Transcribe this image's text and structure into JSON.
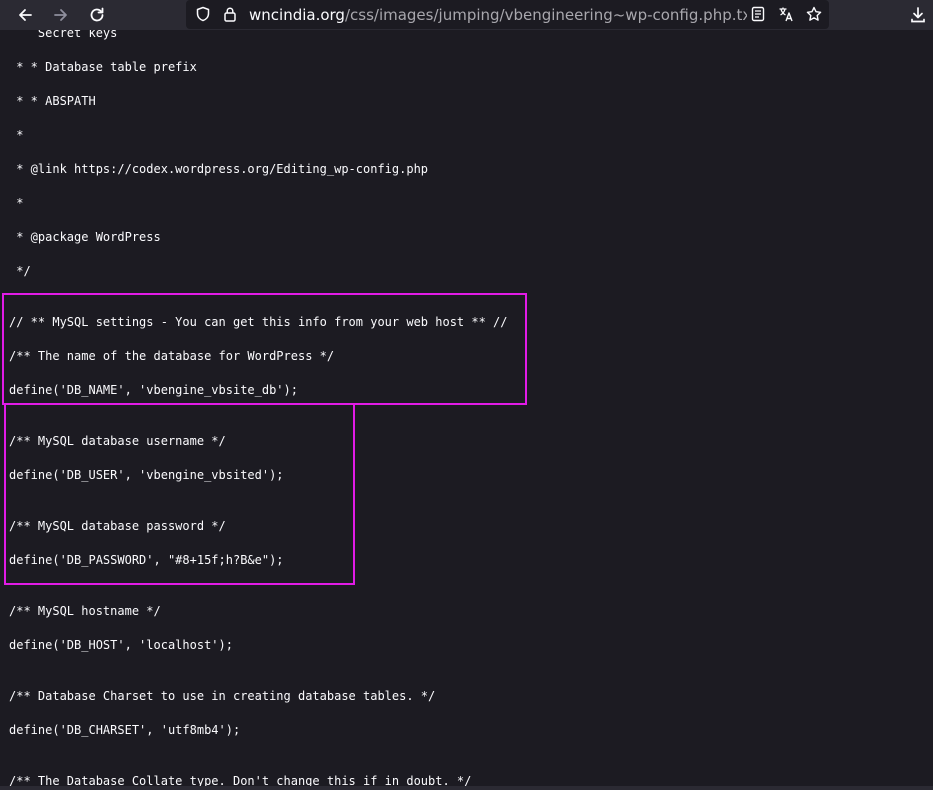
{
  "browser": {
    "url_host": "wncindia.org",
    "url_path": "/css/images/jumping/vbengineering~wp-config.php.txt",
    "icons": [
      "back-icon",
      "forward-icon",
      "reload-icon",
      "shield-icon",
      "lock-icon",
      "reader-view-icon",
      "translate-icon",
      "bookmark-star-icon",
      "downloads-icon"
    ]
  },
  "file_lines": [
    "    Secret keys",
    " * * Database table prefix",
    " * * ABSPATH",
    " *",
    " * @link https://codex.wordpress.org/Editing_wp-config.php",
    " *",
    " * @package WordPress",
    " */",
    "// ** MySQL settings - You can get this info from your web host ** //",
    "/** The name of the database for WordPress */",
    "define('DB_NAME', 'vbengine_vbsite_db');",
    "/** MySQL database username */",
    "define('DB_USER', 'vbengine_vbsited');",
    "/** MySQL database password */",
    "define('DB_PASSWORD', \"#8+15f;h?B&e\");",
    "/** MySQL hostname */",
    "define('DB_HOST', 'localhost');",
    "/** Database Charset to use in creating database tables. */",
    "define('DB_CHARSET', 'utf8mb4');",
    "/** The Database Collate type. Don't change this if in doubt. */"
  ],
  "colors": {
    "page_bg": "#1c1b22",
    "toolbar_bg": "#2b2a33",
    "text": "#fbfbfe",
    "highlight_border": "#e11be6"
  }
}
